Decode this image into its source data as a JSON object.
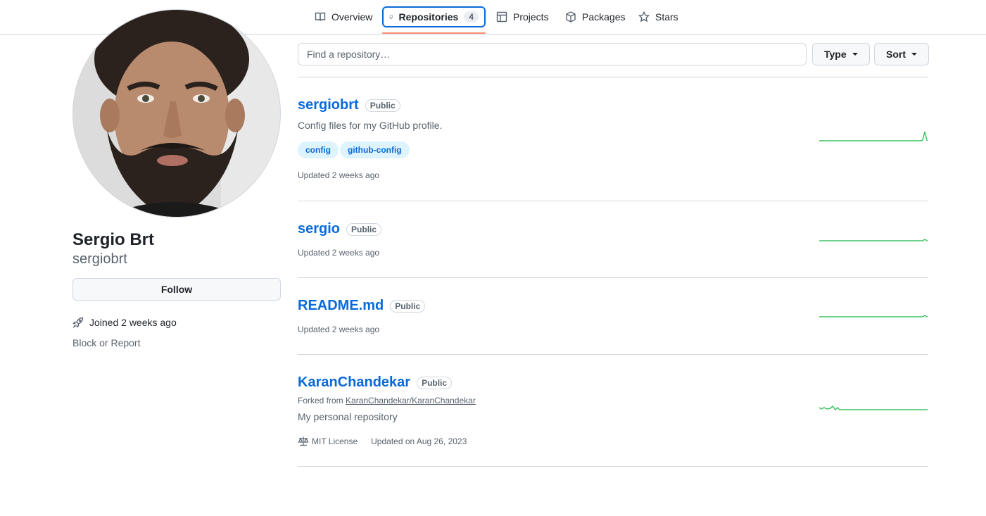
{
  "nav": {
    "tabs": [
      {
        "label": "Overview",
        "icon": "book-icon"
      },
      {
        "label": "Repositories",
        "icon": "repo-icon",
        "count": "4",
        "active": true
      },
      {
        "label": "Projects",
        "icon": "table-icon"
      },
      {
        "label": "Packages",
        "icon": "package-icon"
      },
      {
        "label": "Stars",
        "icon": "star-icon"
      }
    ]
  },
  "profile": {
    "name": "Sergio Brt",
    "login": "sergiobrt",
    "follow_label": "Follow",
    "joined": "Joined 2 weeks ago",
    "block_label": "Block or Report"
  },
  "filters": {
    "search_placeholder": "Find a repository…",
    "type_label": "Type",
    "sort_label": "Sort"
  },
  "repos": [
    {
      "name": "sergiobrt",
      "visibility": "Public",
      "description": "Config files for my GitHub profile.",
      "topics": [
        "config",
        "github-config"
      ],
      "updated": "Updated 2 weeks ago"
    },
    {
      "name": "sergio",
      "visibility": "Public",
      "updated": "Updated 2 weeks ago"
    },
    {
      "name": "README.md",
      "visibility": "Public",
      "updated": "Updated 2 weeks ago"
    },
    {
      "name": "KaranChandekar",
      "visibility": "Public",
      "forked_prefix": "Forked from",
      "forked_from": "KaranChandekar/KaranChandekar",
      "description": "My personal repository",
      "license": "MIT License",
      "updated": "Updated on Aug 26, 2023"
    }
  ],
  "colors": {
    "link": "#0969da",
    "tab_underline": "#fd8c73",
    "sparkline": "#40c463"
  }
}
